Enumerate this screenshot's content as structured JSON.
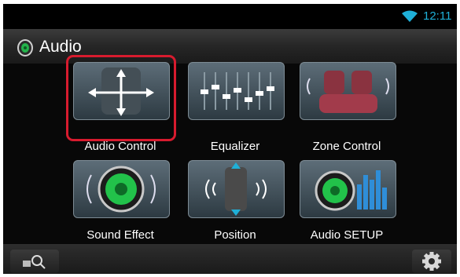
{
  "status": {
    "time": "12:11",
    "wifi_icon": "wifi-icon"
  },
  "header": {
    "title": "Audio",
    "icon": "speaker-icon"
  },
  "tiles": [
    {
      "label": "Audio Control",
      "icon": "audio-control-cross-icon",
      "selected": true
    },
    {
      "label": "Equalizer",
      "icon": "equalizer-sliders-icon"
    },
    {
      "label": "Zone Control",
      "icon": "car-seats-icon"
    },
    {
      "label": "Sound Effect",
      "icon": "green-speaker-icon"
    },
    {
      "label": "Position",
      "icon": "seat-position-icon"
    },
    {
      "label": "Audio SETUP",
      "icon": "speaker-levels-icon"
    }
  ],
  "bottombar": {
    "left_icon": "source-search-icon",
    "right_icon": "gear-icon"
  },
  "colors": {
    "highlight": "#d71b2e",
    "clock": "#1fb0d8",
    "accent_green": "#22c24a"
  }
}
